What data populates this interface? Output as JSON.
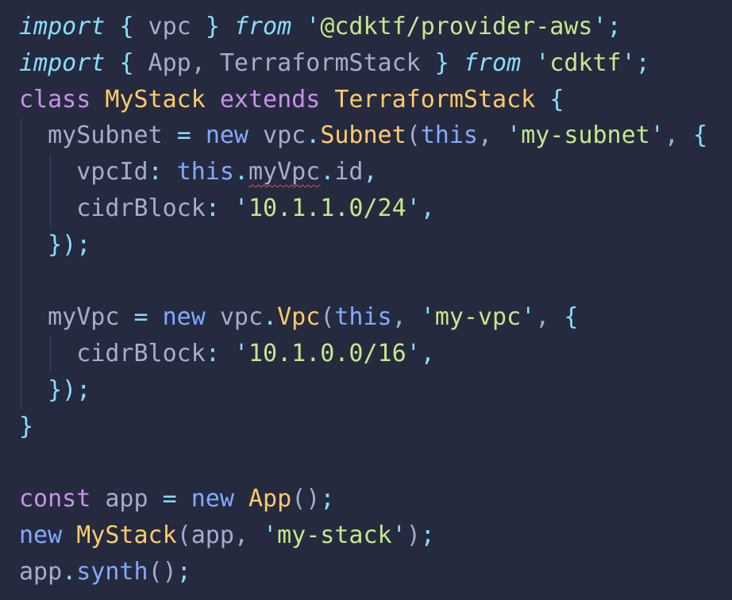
{
  "editor": {
    "background": "#262a3f",
    "lines": [
      {
        "tokens": [
          {
            "t": "import",
            "c": "kw-it"
          },
          {
            "t": " ",
            "c": "plain"
          },
          {
            "t": "{",
            "c": "punc"
          },
          {
            "t": " vpc ",
            "c": "plain"
          },
          {
            "t": "}",
            "c": "punc"
          },
          {
            "t": " ",
            "c": "plain"
          },
          {
            "t": "from",
            "c": "kw-it"
          },
          {
            "t": " ",
            "c": "plain"
          },
          {
            "t": "'",
            "c": "punc"
          },
          {
            "t": "@cdktf/provider-aws",
            "c": "str"
          },
          {
            "t": "'",
            "c": "punc"
          },
          {
            "t": ";",
            "c": "punc"
          }
        ],
        "guides": 0
      },
      {
        "tokens": [
          {
            "t": "import",
            "c": "kw-it"
          },
          {
            "t": " ",
            "c": "plain"
          },
          {
            "t": "{",
            "c": "punc"
          },
          {
            "t": " App, TerraformStack ",
            "c": "plain"
          },
          {
            "t": "}",
            "c": "punc"
          },
          {
            "t": " ",
            "c": "plain"
          },
          {
            "t": "from",
            "c": "kw-it"
          },
          {
            "t": " ",
            "c": "plain"
          },
          {
            "t": "'",
            "c": "punc"
          },
          {
            "t": "cdktf",
            "c": "str"
          },
          {
            "t": "'",
            "c": "punc"
          },
          {
            "t": ";",
            "c": "punc"
          }
        ],
        "guides": 0
      },
      {
        "tokens": [
          {
            "t": "class",
            "c": "kw"
          },
          {
            "t": " ",
            "c": "plain"
          },
          {
            "t": "MyStack",
            "c": "cls"
          },
          {
            "t": " ",
            "c": "plain"
          },
          {
            "t": "extends",
            "c": "kw"
          },
          {
            "t": " ",
            "c": "plain"
          },
          {
            "t": "TerraformStack",
            "c": "cls"
          },
          {
            "t": " ",
            "c": "plain"
          },
          {
            "t": "{",
            "c": "punc"
          }
        ],
        "guides": 0
      },
      {
        "tokens": [
          {
            "t": "  mySubnet ",
            "c": "plain"
          },
          {
            "t": "=",
            "c": "punc"
          },
          {
            "t": " ",
            "c": "plain"
          },
          {
            "t": "new",
            "c": "kw-blue"
          },
          {
            "t": " vpc",
            "c": "plain"
          },
          {
            "t": ".",
            "c": "punc"
          },
          {
            "t": "Subnet",
            "c": "fn"
          },
          {
            "t": "(",
            "c": "plain"
          },
          {
            "t": "this",
            "c": "this"
          },
          {
            "t": ", ",
            "c": "plain"
          },
          {
            "t": "'",
            "c": "punc"
          },
          {
            "t": "my-subnet",
            "c": "str"
          },
          {
            "t": "'",
            "c": "punc"
          },
          {
            "t": ", ",
            "c": "plain"
          },
          {
            "t": "{",
            "c": "punc"
          }
        ],
        "guides": 1
      },
      {
        "tokens": [
          {
            "t": "    vpcId",
            "c": "plain"
          },
          {
            "t": ":",
            "c": "punc"
          },
          {
            "t": " ",
            "c": "plain"
          },
          {
            "t": "this",
            "c": "this"
          },
          {
            "t": ".",
            "c": "punc"
          },
          {
            "t": "myVpc",
            "c": "plain err"
          },
          {
            "t": ".",
            "c": "punc"
          },
          {
            "t": "id",
            "c": "plain"
          },
          {
            "t": ",",
            "c": "punc"
          }
        ],
        "guides": 2
      },
      {
        "tokens": [
          {
            "t": "    cidrBlock",
            "c": "plain"
          },
          {
            "t": ":",
            "c": "punc"
          },
          {
            "t": " ",
            "c": "plain"
          },
          {
            "t": "'",
            "c": "punc"
          },
          {
            "t": "10.1.1.0/24",
            "c": "str"
          },
          {
            "t": "'",
            "c": "punc"
          },
          {
            "t": ",",
            "c": "punc"
          }
        ],
        "guides": 2
      },
      {
        "tokens": [
          {
            "t": "  ",
            "c": "plain"
          },
          {
            "t": "})",
            "c": "punc"
          },
          {
            "t": ";",
            "c": "punc"
          }
        ],
        "guides": 1
      },
      {
        "tokens": [
          {
            "t": "",
            "c": "plain"
          }
        ],
        "guides": 1
      },
      {
        "tokens": [
          {
            "t": "  myVpc ",
            "c": "plain"
          },
          {
            "t": "=",
            "c": "punc"
          },
          {
            "t": " ",
            "c": "plain"
          },
          {
            "t": "new",
            "c": "kw-blue"
          },
          {
            "t": " vpc",
            "c": "plain"
          },
          {
            "t": ".",
            "c": "punc"
          },
          {
            "t": "Vpc",
            "c": "fn"
          },
          {
            "t": "(",
            "c": "plain"
          },
          {
            "t": "this",
            "c": "this"
          },
          {
            "t": ", ",
            "c": "plain"
          },
          {
            "t": "'",
            "c": "punc"
          },
          {
            "t": "my-vpc",
            "c": "str"
          },
          {
            "t": "'",
            "c": "punc"
          },
          {
            "t": ", ",
            "c": "plain"
          },
          {
            "t": "{",
            "c": "punc"
          }
        ],
        "guides": 1
      },
      {
        "tokens": [
          {
            "t": "    cidrBlock",
            "c": "plain"
          },
          {
            "t": ":",
            "c": "punc"
          },
          {
            "t": " ",
            "c": "plain"
          },
          {
            "t": "'",
            "c": "punc"
          },
          {
            "t": "10.1.0.0/16",
            "c": "str"
          },
          {
            "t": "'",
            "c": "punc"
          },
          {
            "t": ",",
            "c": "punc"
          }
        ],
        "guides": 2
      },
      {
        "tokens": [
          {
            "t": "  ",
            "c": "plain"
          },
          {
            "t": "})",
            "c": "punc"
          },
          {
            "t": ";",
            "c": "punc"
          }
        ],
        "guides": 1
      },
      {
        "tokens": [
          {
            "t": "}",
            "c": "punc"
          }
        ],
        "guides": 0
      },
      {
        "tokens": [
          {
            "t": "",
            "c": "plain"
          }
        ],
        "guides": 0
      },
      {
        "tokens": [
          {
            "t": "const",
            "c": "kw"
          },
          {
            "t": " app ",
            "c": "plain"
          },
          {
            "t": "=",
            "c": "punc"
          },
          {
            "t": " ",
            "c": "plain"
          },
          {
            "t": "new",
            "c": "kw-blue"
          },
          {
            "t": " ",
            "c": "plain"
          },
          {
            "t": "App",
            "c": "fn"
          },
          {
            "t": "()",
            "c": "plain"
          },
          {
            "t": ";",
            "c": "punc"
          }
        ],
        "guides": 0
      },
      {
        "tokens": [
          {
            "t": "new",
            "c": "kw-blue"
          },
          {
            "t": " ",
            "c": "plain"
          },
          {
            "t": "MyStack",
            "c": "fn"
          },
          {
            "t": "(app, ",
            "c": "plain"
          },
          {
            "t": "'",
            "c": "punc"
          },
          {
            "t": "my-stack",
            "c": "str"
          },
          {
            "t": "'",
            "c": "punc"
          },
          {
            "t": ")",
            "c": "plain"
          },
          {
            "t": ";",
            "c": "punc"
          }
        ],
        "guides": 0
      },
      {
        "tokens": [
          {
            "t": "app",
            "c": "plain"
          },
          {
            "t": ".",
            "c": "punc"
          },
          {
            "t": "synth",
            "c": "kw-blue"
          },
          {
            "t": "()",
            "c": "plain"
          },
          {
            "t": ";",
            "c": "punc"
          }
        ],
        "guides": 0
      }
    ]
  }
}
